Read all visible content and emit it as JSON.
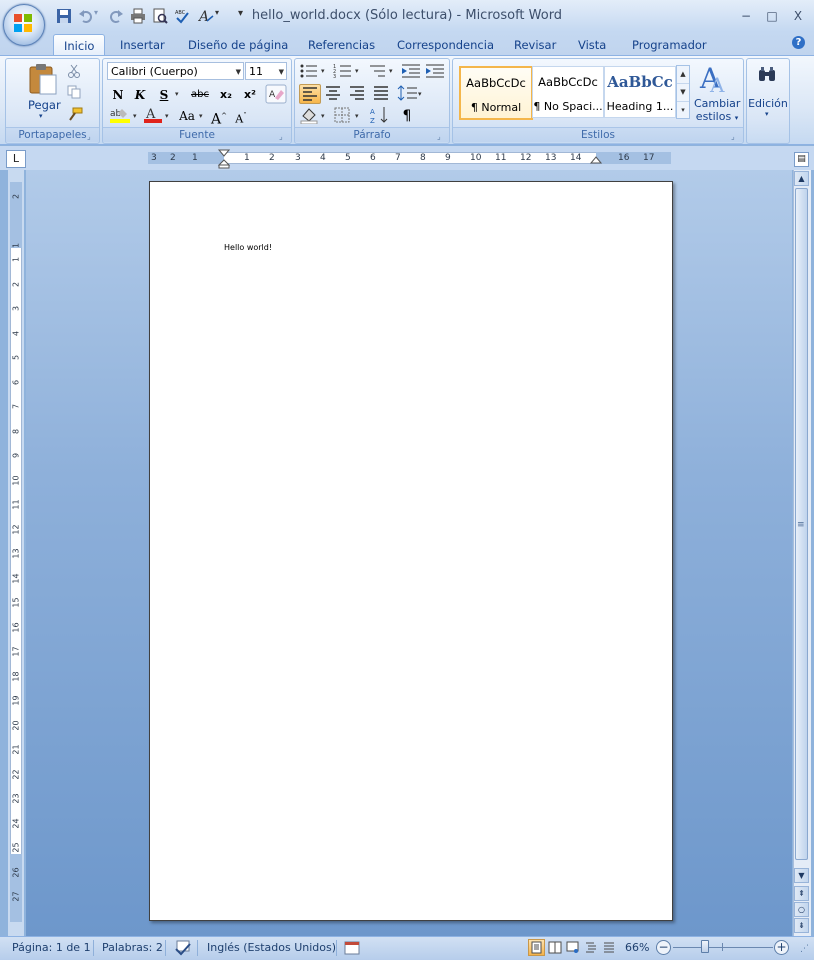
{
  "window": {
    "title": "hello_world.docx (Sólo lectura) - Microsoft Word",
    "minimize": "−",
    "maximize": "□",
    "close": "X"
  },
  "tabs": [
    "Inicio",
    "Insertar",
    "Diseño de página",
    "Referencias",
    "Correspondencia",
    "Revisar",
    "Vista",
    "Programador"
  ],
  "ribbon": {
    "clipboard": {
      "paste_label": "Pegar",
      "group_label": "Portapapeles"
    },
    "font": {
      "font_name": "Calibri (Cuerpo)",
      "font_size": "11",
      "group_label": "Fuente",
      "bold": "N",
      "italic": "K",
      "underline": "S",
      "strike": "abc",
      "subscript": "x₂",
      "superscript": "x²",
      "case": "Aa",
      "grow": "A",
      "shrink": "A"
    },
    "paragraph": {
      "group_label": "Párrafo",
      "pilcrow": "¶"
    },
    "styles": {
      "group_label": "Estilos",
      "items": [
        {
          "sample": "AaBbCcDc",
          "label": "¶ Normal"
        },
        {
          "sample": "AaBbCcDc",
          "label": "¶ No Spaci..."
        },
        {
          "sample": "AaBbCс",
          "label": "Heading 1..."
        }
      ],
      "change_label_1": "Cambiar",
      "change_label_2": "estilos"
    },
    "editing": {
      "label": "Edición"
    }
  },
  "ruler": {
    "h_numbers": [
      "3",
      "2",
      "1",
      "1",
      "2",
      "3",
      "4",
      "5",
      "6",
      "7",
      "8",
      "9",
      "10",
      "11",
      "12",
      "13",
      "14",
      "16",
      "17"
    ],
    "v_numbers": [
      "2",
      "1",
      "1",
      "2",
      "3",
      "4",
      "5",
      "6",
      "7",
      "8",
      "9",
      "10",
      "11",
      "12",
      "13",
      "14",
      "15",
      "16",
      "17",
      "18",
      "19",
      "20",
      "21",
      "22",
      "23",
      "24",
      "25",
      "26",
      "27"
    ]
  },
  "document": {
    "text": "Hello world!"
  },
  "status": {
    "page": "Página: 1 de 1",
    "words": "Palabras: 2",
    "language": "Inglés (Estados Unidos)",
    "zoom": "66%"
  },
  "colors": {
    "accent": "#15428b",
    "selected": "#f7b64b",
    "page_bg": "#ffffff"
  }
}
